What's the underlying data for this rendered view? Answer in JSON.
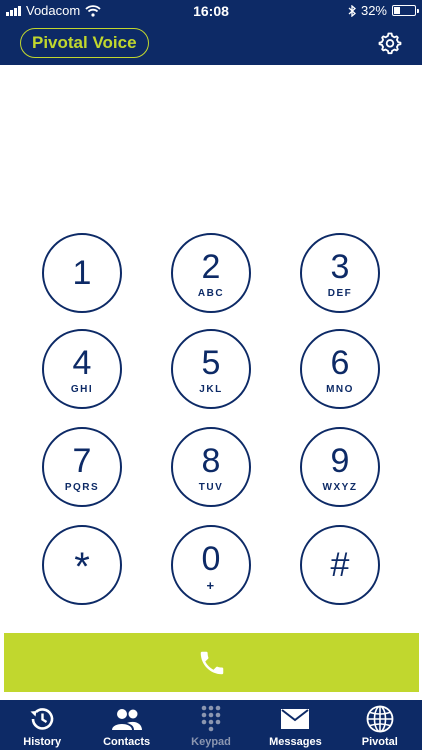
{
  "status_bar": {
    "carrier": "Vodacom",
    "time": "16:08",
    "battery_percent": "32%",
    "battery_level": 0.32
  },
  "header": {
    "brand": "Pivotal Voice",
    "settings_icon": "gear-icon"
  },
  "keypad": {
    "keys": [
      {
        "digit": "1",
        "letters": ""
      },
      {
        "digit": "2",
        "letters": "ABC"
      },
      {
        "digit": "3",
        "letters": "DEF"
      },
      {
        "digit": "4",
        "letters": "GHI"
      },
      {
        "digit": "5",
        "letters": "JKL"
      },
      {
        "digit": "6",
        "letters": "MNO"
      },
      {
        "digit": "7",
        "letters": "PQRS"
      },
      {
        "digit": "8",
        "letters": "TUV"
      },
      {
        "digit": "9",
        "letters": "WXYZ"
      },
      {
        "digit": "*",
        "letters": ""
      },
      {
        "digit": "0",
        "letters": "+"
      },
      {
        "digit": "#",
        "letters": ""
      }
    ]
  },
  "call_button": {
    "icon": "phone-icon",
    "color": "#c1d72e"
  },
  "tabs": [
    {
      "label": "History",
      "icon": "history-icon"
    },
    {
      "label": "Contacts",
      "icon": "contacts-icon"
    },
    {
      "label": "Keypad",
      "icon": "keypad-icon",
      "active": true
    },
    {
      "label": "Messages",
      "icon": "messages-icon"
    },
    {
      "label": "Pivotal",
      "icon": "globe-icon"
    }
  ],
  "colors": {
    "primary": "#0d2a66",
    "accent": "#c1d72e",
    "inactive_tab": "#8b96b0"
  }
}
